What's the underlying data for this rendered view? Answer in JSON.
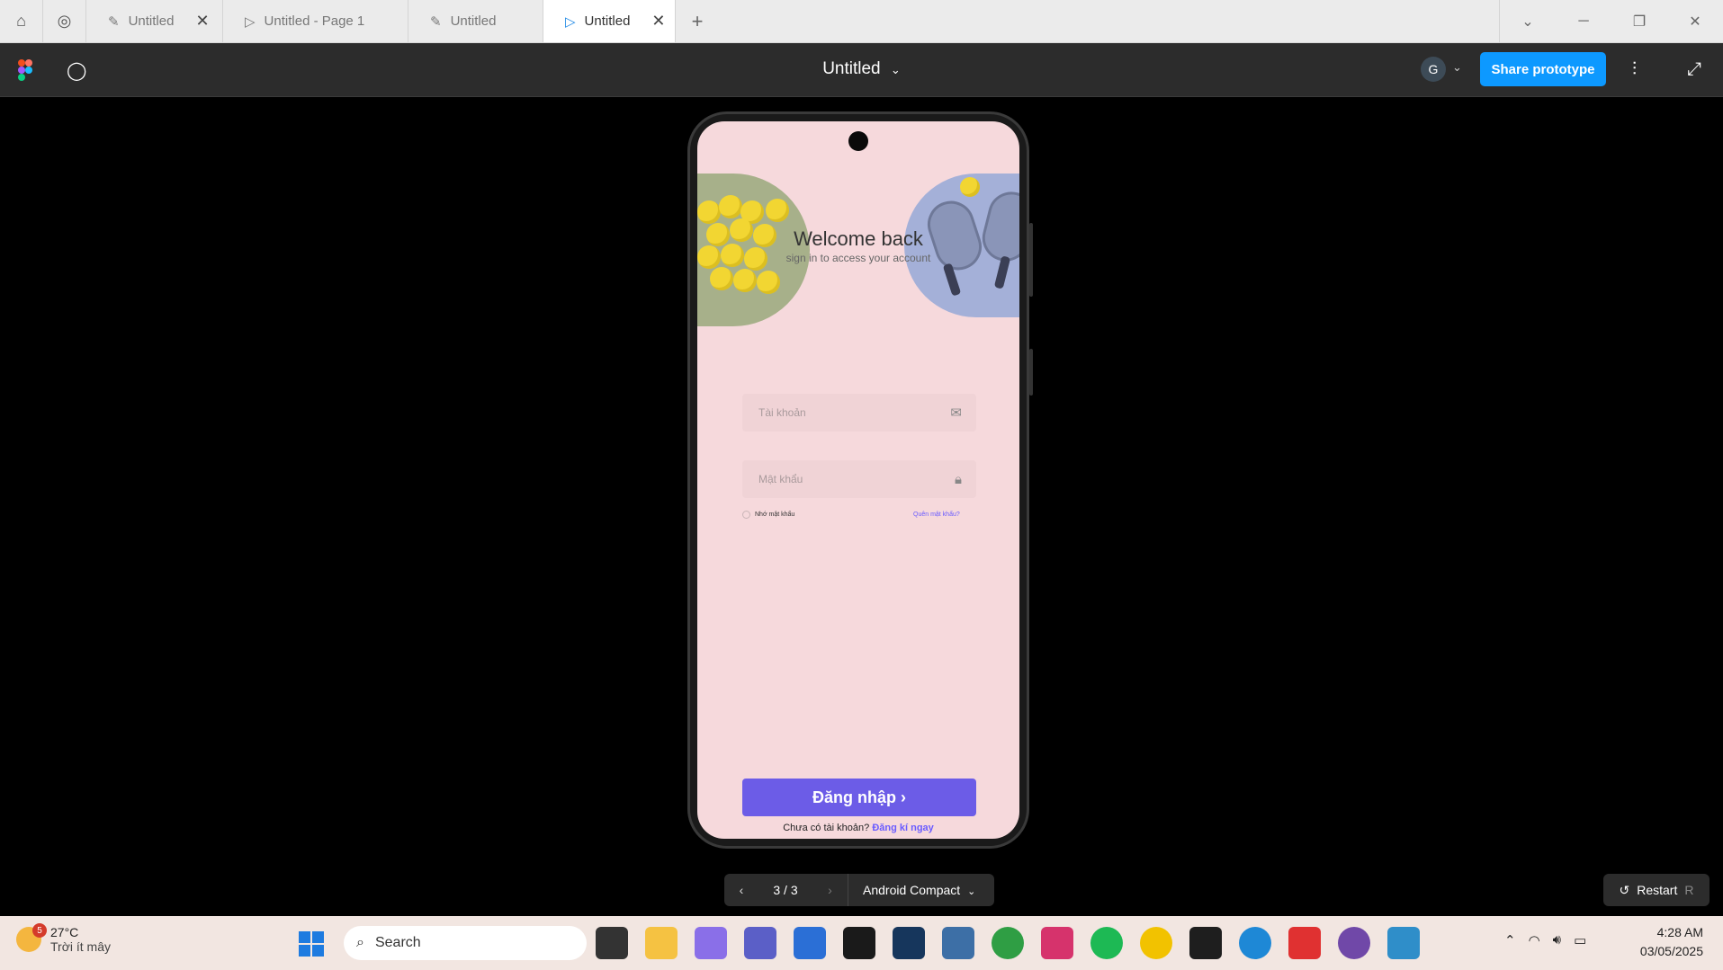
{
  "browser": {
    "tabs": [
      {
        "label": "Untitled",
        "icon": "pen-tool-icon"
      },
      {
        "label": "Untitled - Page 1",
        "icon": "play-icon"
      },
      {
        "label": "Untitled",
        "icon": "pen-tool-icon"
      },
      {
        "label": "Untitled",
        "icon": "play-icon",
        "active": true
      }
    ]
  },
  "toolbar": {
    "file_title": "Untitled",
    "avatar_initial": "G",
    "share_label": "Share prototype"
  },
  "app": {
    "title": "Welcome back",
    "subtitle": "sign in to access your account",
    "username_placeholder": "Tài khoản",
    "password_placeholder": "Mật khẩu",
    "remember_label": "Nhớ mật khẩu",
    "forgot_label": "Quên mật khẩu?",
    "login_label": "Đăng nhập ›",
    "no_account": "Chưa có tài khoản?",
    "signup_link": "Đăng kí ngay",
    "colors": {
      "background": "#f6d9dc",
      "accent": "#6c5ce7"
    }
  },
  "pager": {
    "count": "3 / 3",
    "device": "Android Compact"
  },
  "restart": {
    "label": "Restart",
    "shortcut": "R"
  },
  "taskbar": {
    "badge": "5",
    "temp": "27°C",
    "weather": "Trời ít mây",
    "search": "Search",
    "time": "4:28 AM",
    "date": "03/05/2025"
  }
}
